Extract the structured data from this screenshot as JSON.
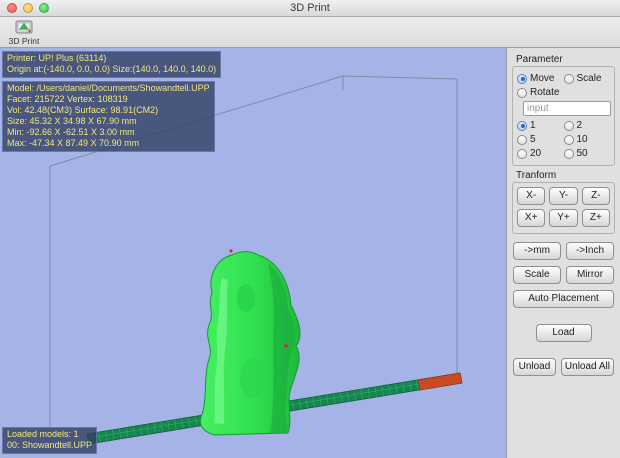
{
  "window": {
    "title": "3D Print"
  },
  "toolbar": {
    "print_label": "3D Print"
  },
  "viewport": {
    "printer_info": {
      "line1": "Printer: UP! Plus (63114)",
      "line2": "Origin at:(-140.0, 0.0, 0.0)   Size:(140.0, 140.0, 140.0)"
    },
    "model_info": {
      "line1": "Model: /Users/daniel/Documents/Showandtell.UPP",
      "line2": "Facet: 215722    Vertex: 108319",
      "line3": "Vol: 42.48(CM3)    Surface: 98.91(CM2)",
      "line4": "Size: 45.32 X 34.98 X 67.90 mm",
      "line5": "Min: -92.66 X -62.51 X 3.00 mm",
      "line6": "Max: -47.34 X 87.49 X 70.90 mm"
    },
    "loaded_models": {
      "line1": "Loaded models: 1",
      "line2": "00: Showandtell.UPP"
    },
    "colors": {
      "background": "#a6b3e6",
      "model": "#2fe04e",
      "platform": "#17854f",
      "platform_grid": "#3fd080",
      "platform_edge_strip": "#cc4a22"
    }
  },
  "sidebar": {
    "parameter_group": {
      "title": "Parameter",
      "modes": [
        {
          "label": "Move",
          "selected": true
        },
        {
          "label": "Scale",
          "selected": false
        },
        {
          "label": "Rotate",
          "selected": false
        }
      ],
      "input_placeholder": "input",
      "steps": [
        {
          "label": "1",
          "selected": true
        },
        {
          "label": "2",
          "selected": false
        },
        {
          "label": "5",
          "selected": false
        },
        {
          "label": "10",
          "selected": false
        },
        {
          "label": "20",
          "selected": false
        },
        {
          "label": "50",
          "selected": false
        }
      ]
    },
    "transform_group": {
      "title": "Tranform",
      "buttons": [
        "X-",
        "Y-",
        "Z-",
        "X+",
        "Y+",
        "Z+"
      ]
    },
    "buttons": {
      "to_mm": "->mm",
      "to_inch": "->Inch",
      "scale": "Scale",
      "mirror": "Mirror",
      "auto_placement": "Auto Placement",
      "load": "Load",
      "unload": "Unload",
      "unload_all": "Unload All"
    }
  }
}
